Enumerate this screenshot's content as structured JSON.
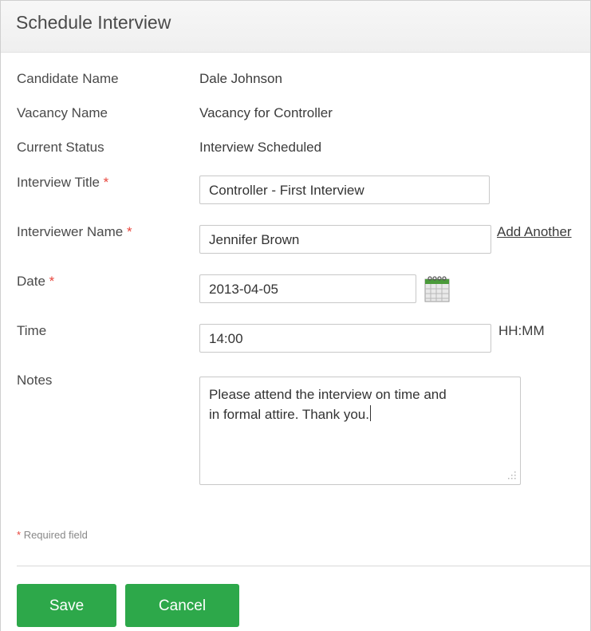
{
  "dialog": {
    "title": "Schedule Interview"
  },
  "info": {
    "candidate_label": "Candidate Name",
    "candidate_value": "Dale Johnson",
    "vacancy_label": "Vacancy Name",
    "vacancy_value": "Vacancy for Controller",
    "status_label": "Current Status",
    "status_value": "Interview Scheduled"
  },
  "form": {
    "required_marker": "*",
    "interview_title": {
      "label": "Interview Title",
      "value": "Controller - First Interview"
    },
    "interviewer_name": {
      "label": "Interviewer Name",
      "value": "Jennifer Brown",
      "add_link": "Add Another"
    },
    "date": {
      "label": "Date",
      "value": "2013-04-05",
      "icon": "calendar-icon"
    },
    "time": {
      "label": "Time",
      "value": "14:00",
      "hint": "HH:MM"
    },
    "notes": {
      "label": "Notes",
      "line1": "Please attend the interview on time and",
      "line2": "in formal attire. Thank you."
    }
  },
  "footer": {
    "required_note": "Required field",
    "save_label": "Save",
    "cancel_label": "Cancel"
  },
  "colors": {
    "button_green": "#2da84a",
    "required_red": "#e8453c"
  }
}
